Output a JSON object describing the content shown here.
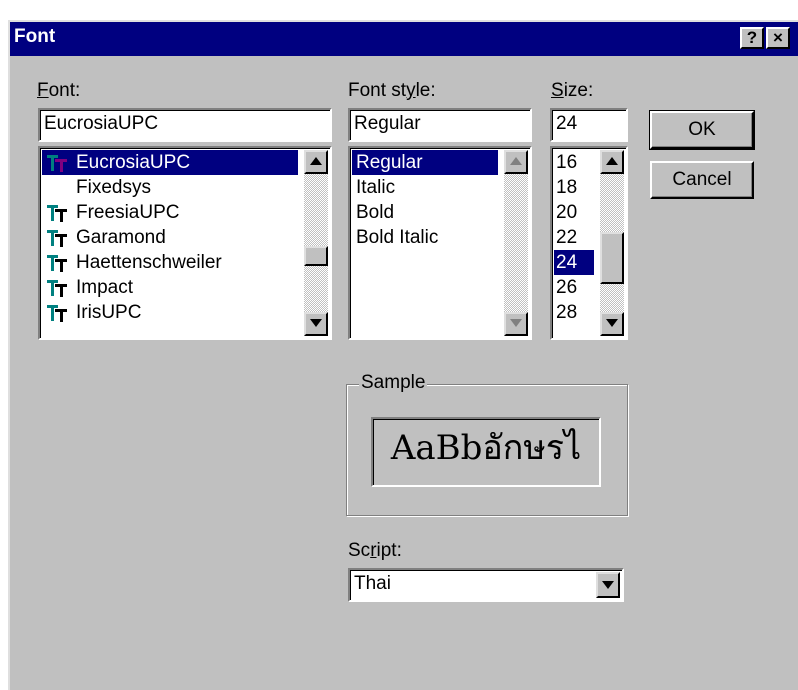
{
  "window": {
    "title": "Font",
    "help_button": "?",
    "close_button": "×"
  },
  "font": {
    "label_hotkey": "F",
    "label_rest": "ont:",
    "value": "EucrosiaUPC",
    "items": [
      {
        "label": "EucrosiaUPC",
        "icon": "truetype-icon",
        "selected": true
      },
      {
        "label": "Fixedsys",
        "icon": "none",
        "selected": false
      },
      {
        "label": "FreesiaUPC",
        "icon": "truetype-icon",
        "selected": false
      },
      {
        "label": "Garamond",
        "icon": "truetype-icon",
        "selected": false
      },
      {
        "label": "Haettenschweiler",
        "icon": "truetype-icon",
        "selected": false
      },
      {
        "label": "Impact",
        "icon": "truetype-icon",
        "selected": false
      },
      {
        "label": "IrisUPC",
        "icon": "truetype-icon",
        "selected": false
      }
    ]
  },
  "style": {
    "label_pre": "Font st",
    "label_hotkey": "y",
    "label_post": "le:",
    "value": "Regular",
    "items": [
      {
        "label": "Regular",
        "selected": true
      },
      {
        "label": "Italic",
        "selected": false
      },
      {
        "label": "Bold",
        "selected": false
      },
      {
        "label": "Bold Italic",
        "selected": false
      }
    ]
  },
  "size": {
    "label_hotkey": "S",
    "label_rest": "ize:",
    "value": "24",
    "items": [
      {
        "label": "16",
        "selected": false
      },
      {
        "label": "18",
        "selected": false
      },
      {
        "label": "20",
        "selected": false
      },
      {
        "label": "22",
        "selected": false
      },
      {
        "label": "24",
        "selected": true
      },
      {
        "label": "26",
        "selected": false
      },
      {
        "label": "28",
        "selected": false
      }
    ]
  },
  "buttons": {
    "ok": "OK",
    "cancel": "Cancel"
  },
  "sample": {
    "title": "Sample",
    "text": "AaBbอักษรไ"
  },
  "script": {
    "label_pre": "Sc",
    "label_hotkey": "r",
    "label_post": "ipt:",
    "value": "Thai"
  },
  "colors": {
    "face": "#c0c0c0",
    "titlebar": "#000080",
    "selection": "#000080",
    "truetype_icon_teal": "#008080",
    "truetype_icon_magenta": "#800080"
  }
}
